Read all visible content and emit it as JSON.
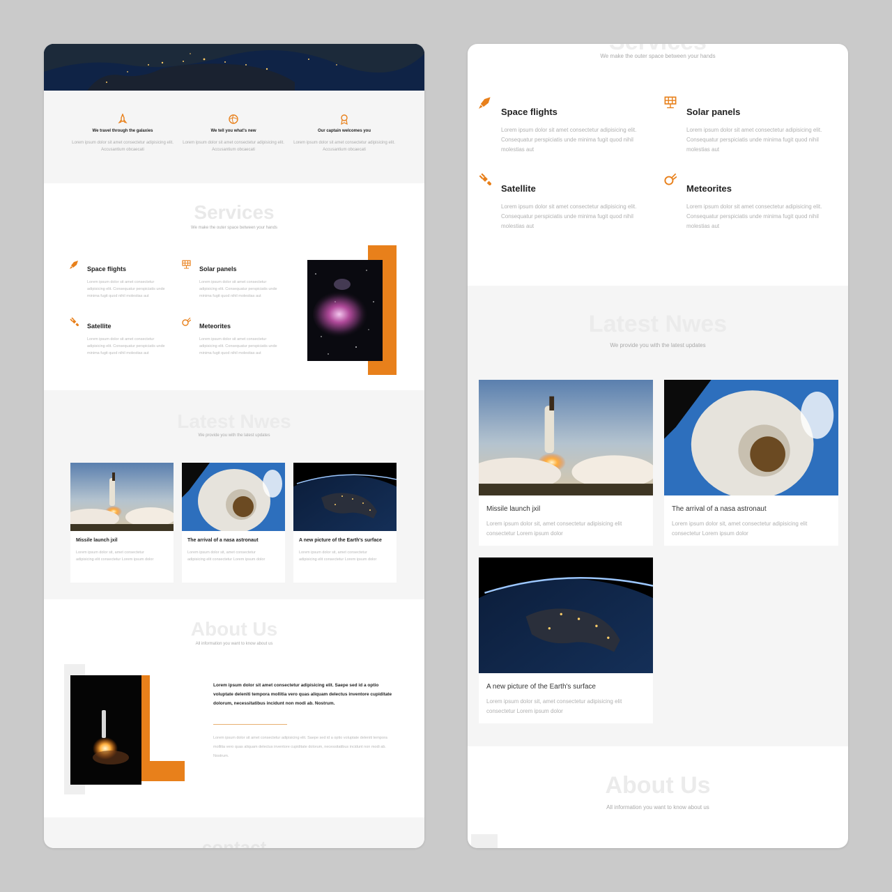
{
  "left": {
    "features": [
      {
        "icon": "rocket-icon",
        "title": "We travel through the galaxies",
        "text": "Lorem ipsum dolor sit amet consectetur adipisicing elit. Accusantium obcaecati"
      },
      {
        "icon": "globe-icon",
        "title": "We tell you what's new",
        "text": "Lorem ipsum dolor sit amet consectetur adipisicing elit. Accusantium obcaecati"
      },
      {
        "icon": "badge-icon",
        "title": "Our captain welcomes you",
        "text": "Lorem ipsum dolor sit amet consectetur adipisicing elit. Accusantium obcaecati"
      }
    ],
    "services": {
      "title": "Services",
      "subtitle": "We make the outer space between your hands",
      "items": [
        {
          "icon": "rocket-icon",
          "title": "Space flights",
          "text": "Lorem ipsum dolor sit amet consectetur adipisicing elit. Consequatur perspiciatis unde minima fugit quod nihil molestias aut"
        },
        {
          "icon": "solar-panel-icon",
          "title": "Solar panels",
          "text": "Lorem ipsum dolor sit amet consectetur adipisicing elit. Consequatur perspiciatis unde minima fugit quod nihil molestias aut"
        },
        {
          "icon": "satellite-icon",
          "title": "Satellite",
          "text": "Lorem ipsum dolor sit amet consectetur adipisicing elit. Consequatur perspiciatis unde minima fugit quod nihil molestias aut"
        },
        {
          "icon": "meteor-icon",
          "title": "Meteorites",
          "text": "Lorem ipsum dolor sit amet consectetur adipisicing elit. Consequatur perspiciatis unde minima fugit quod nihil molestias aut"
        }
      ]
    },
    "news": {
      "title": "Latest Nwes",
      "subtitle": "We provide you with the latest updates",
      "items": [
        {
          "image": "rocket-launch-image",
          "title": "Missile launch jxil",
          "text": "Lorem ipsum dolor sit, amet consectetur adipisicing elit consectetur Lorem ipsum dolor"
        },
        {
          "image": "astronaut-image",
          "title": "The arrival of a nasa astronaut",
          "text": "Lorem ipsum dolor sit, amet consectetur adipisicing elit consectetur Lorem ipsum dolor"
        },
        {
          "image": "earth-night-image",
          "title": "A new picture of the Earth's surface",
          "text": "Lorem ipsum dolor sit, amet consectetur adipisicing elit consectetur Lorem ipsum dolor"
        }
      ]
    },
    "about": {
      "title": "About Us",
      "subtitle": "All information you want to know about us",
      "lead": "Lorem ipsum dolor sit amet consectetur adipisicing elit. Saepe sed id a optio voluptate deleniti tempora mollitia vero quas aliquam delectus inventore cupiditate dolorum, necessitatibus incidunt non modi ab. Nostrum.",
      "body": "Lorem ipsum dolor sit amet consectetur adipisicing elit. Saepe sed id a optio voluptate deleniti tempora mollitia vero quas aliquam delectus inventore cupiditate dolorum, necessitatibus incidunt non modi ab. Nostrum."
    },
    "contact": {
      "title": "contact"
    }
  },
  "right": {
    "services": {
      "title": "Services",
      "subtitle": "We make the outer space between your hands",
      "items": [
        {
          "icon": "rocket-icon",
          "title": "Space flights",
          "text": "Lorem ipsum dolor sit amet consectetur adipisicing elit. Consequatur perspiciatis unde minima fugit quod nihil molestias aut"
        },
        {
          "icon": "solar-panel-icon",
          "title": "Solar panels",
          "text": "Lorem ipsum dolor sit amet consectetur adipisicing elit. Consequatur perspiciatis unde minima fugit quod nihil molestias aut"
        },
        {
          "icon": "satellite-icon",
          "title": "Satellite",
          "text": "Lorem ipsum dolor sit amet consectetur adipisicing elit. Consequatur perspiciatis unde minima fugit quod nihil molestias aut"
        },
        {
          "icon": "meteor-icon",
          "title": "Meteorites",
          "text": "Lorem ipsum dolor sit amet consectetur adipisicing elit. Consequatur perspiciatis unde minima fugit quod nihil molestias aut"
        }
      ]
    },
    "news": {
      "title": "Latest Nwes",
      "subtitle": "We provide you with the latest updates",
      "items": [
        {
          "image": "rocket-launch-image",
          "title": "Missile launch jxil",
          "text": "Lorem ipsum dolor sit, amet consectetur adipisicing elit consectetur Lorem ipsum dolor"
        },
        {
          "image": "astronaut-image",
          "title": "The arrival of a nasa astronaut",
          "text": "Lorem ipsum dolor sit, amet consectetur adipisicing elit consectetur Lorem ipsum dolor"
        },
        {
          "image": "earth-night-image",
          "title": "A new picture of the Earth's surface",
          "text": "Lorem ipsum dolor sit, amet consectetur adipisicing elit consectetur Lorem ipsum dolor"
        }
      ]
    },
    "about": {
      "title": "About Us",
      "subtitle": "All information you want to know about us"
    }
  },
  "colors": {
    "accent": "#e8801b",
    "band": "#f5f5f5",
    "ghost": "#e9e9e9"
  }
}
